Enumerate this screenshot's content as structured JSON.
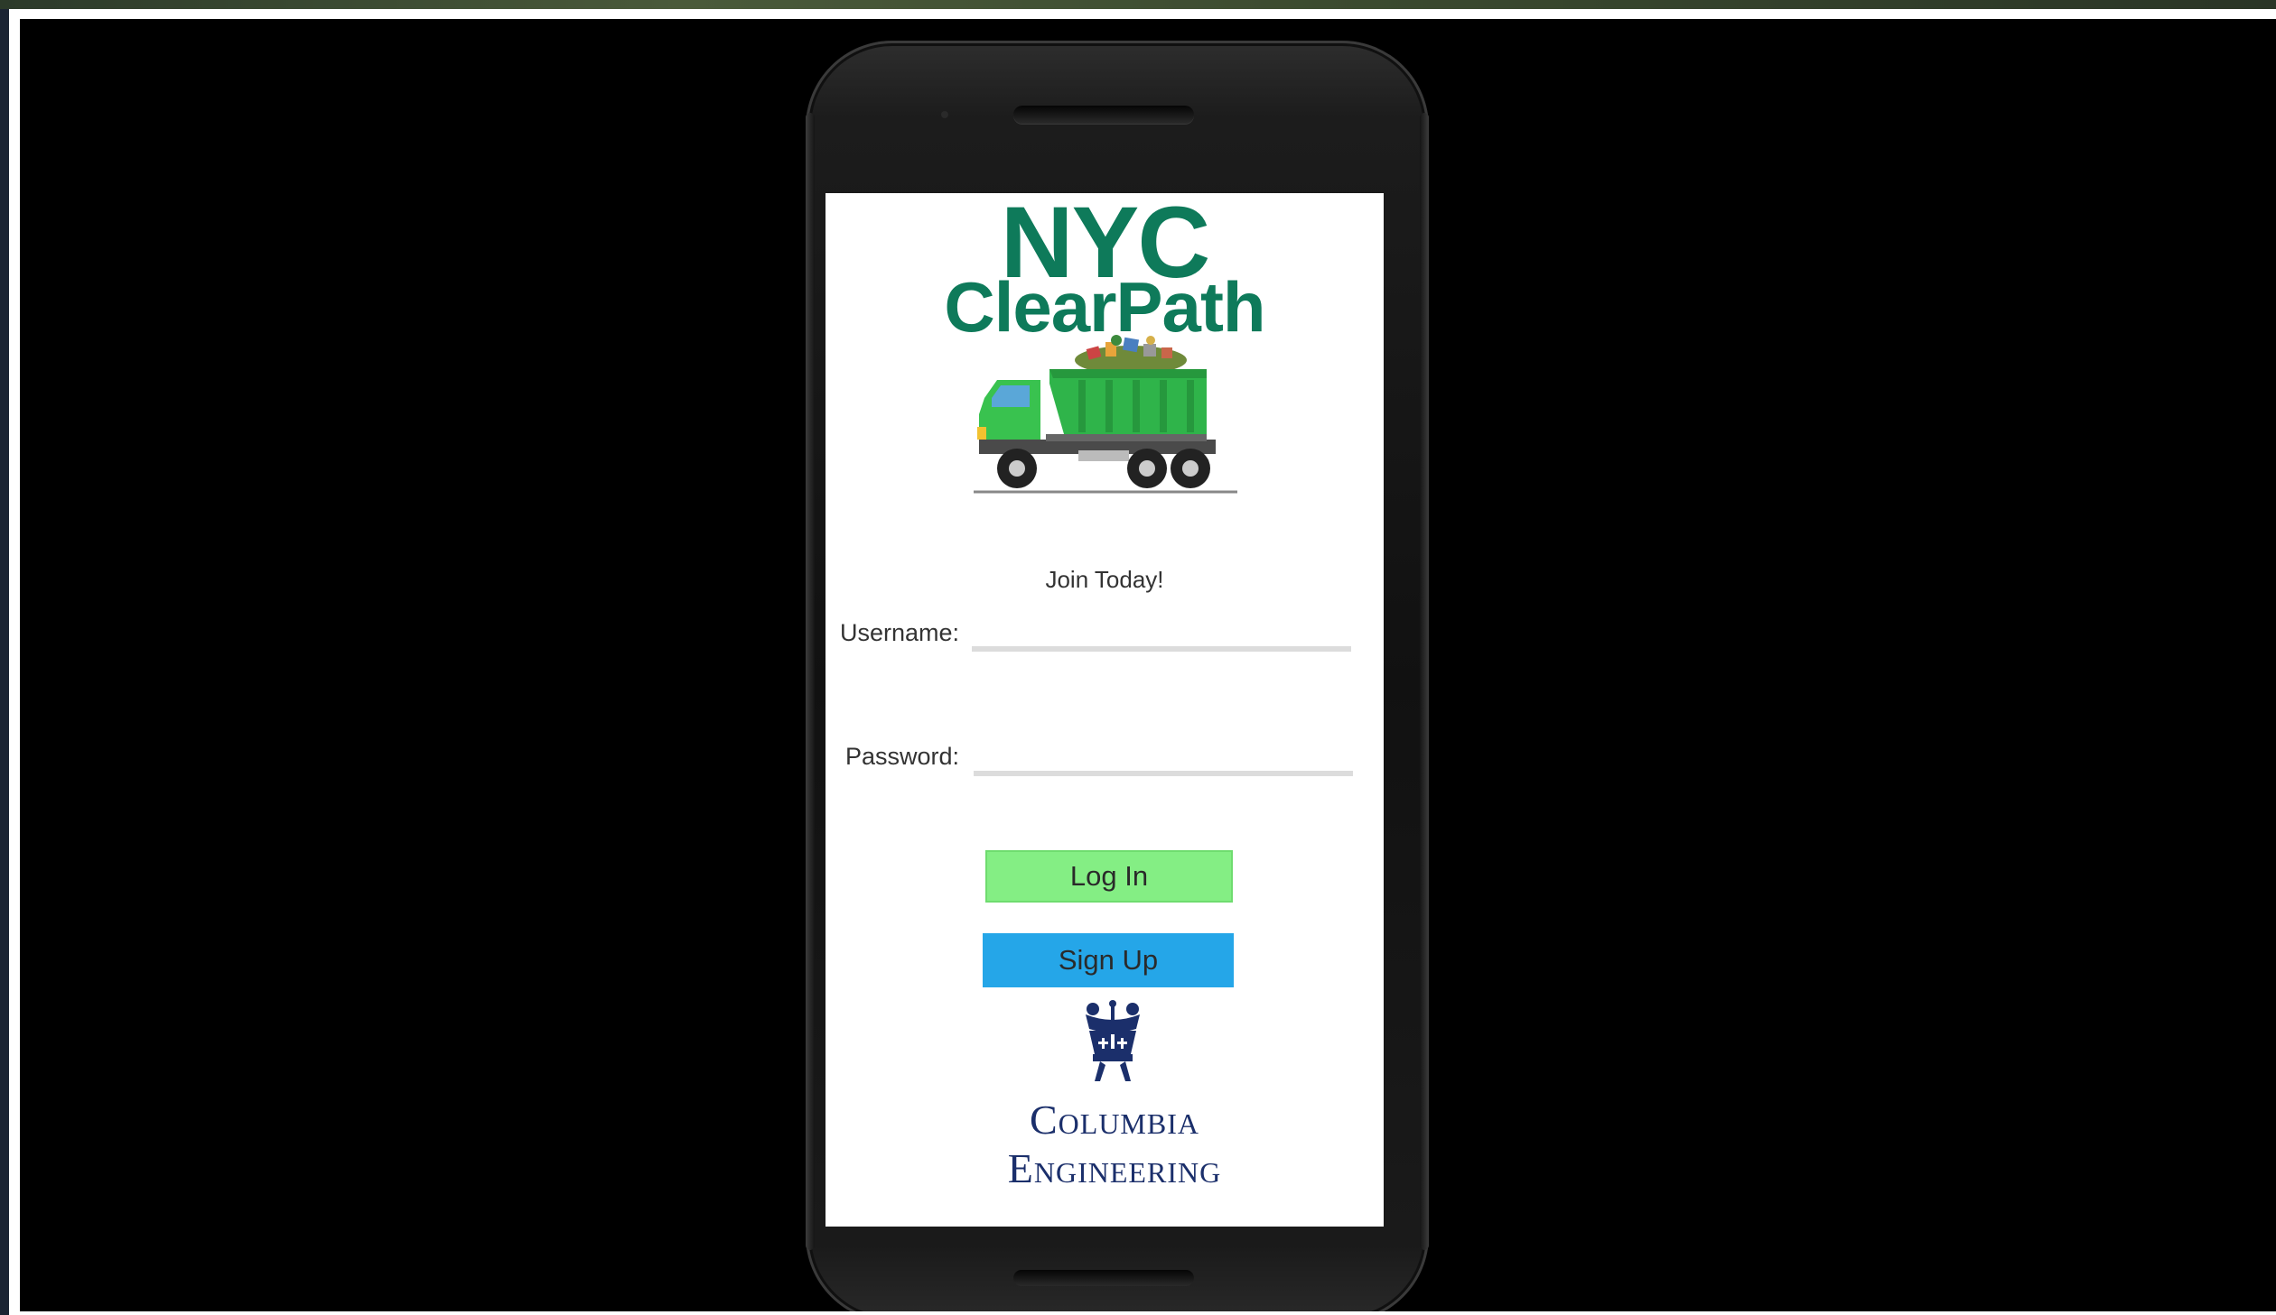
{
  "app": {
    "title_line1": "NYC",
    "title_line2": "ClearPath",
    "brand_color": "#0e7a5a"
  },
  "login": {
    "tagline": "Join Today!",
    "username_label": "Username:",
    "username_value": "",
    "password_label": "Password:",
    "password_value": "",
    "login_button": "Log In",
    "signup_button": "Sign Up",
    "login_color": "#84ee84",
    "signup_color": "#25a6e8"
  },
  "footer": {
    "logo_line1": "Columbia",
    "logo_line2": "Engineering",
    "logo_color": "#1b2f6b"
  },
  "icons": {
    "truck": "garbage-truck-icon",
    "crown": "columbia-crown-icon"
  }
}
